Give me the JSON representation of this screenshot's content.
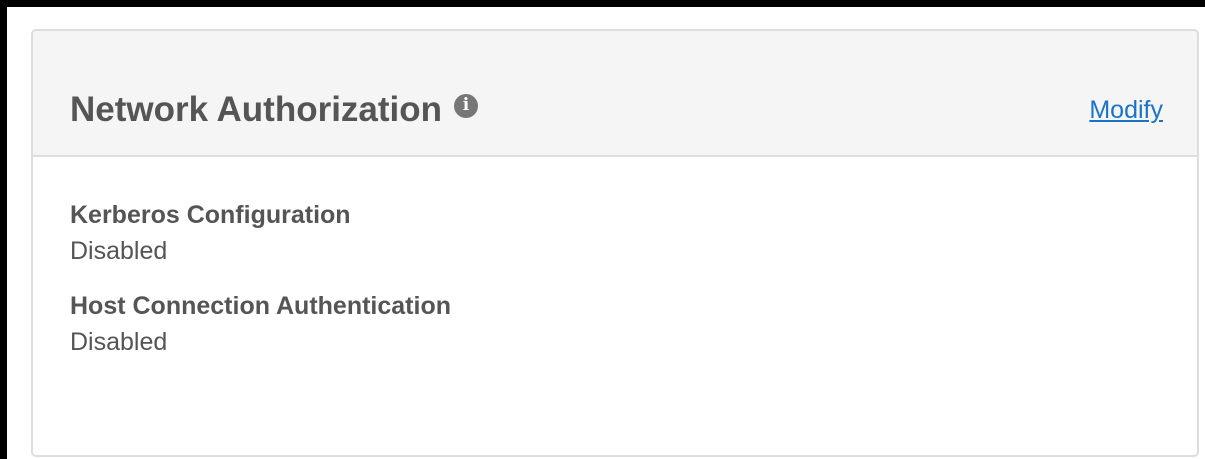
{
  "panel": {
    "title": "Network Authorization",
    "info_icon": "info-circle-icon",
    "modify_label": "Modify"
  },
  "fields": [
    {
      "label": "Kerberos Configuration",
      "value": "Disabled"
    },
    {
      "label": "Host Connection Authentication",
      "value": "Disabled"
    }
  ],
  "colors": {
    "link": "#1a73c8",
    "text": "#555555",
    "header_bg": "#f5f5f5",
    "border": "#dddddd"
  }
}
